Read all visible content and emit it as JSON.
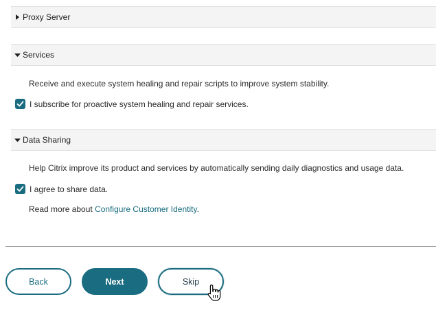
{
  "sections": {
    "proxy": {
      "title": "Proxy Server",
      "expanded": false
    },
    "services": {
      "title": "Services",
      "expanded": true,
      "description": "Receive and execute system healing and repair scripts to improve system stability.",
      "checkbox_label": "I subscribe for proactive system healing and repair services.",
      "checked": true
    },
    "data_sharing": {
      "title": "Data Sharing",
      "expanded": true,
      "description": "Help Citrix improve its product and services by automatically sending daily diagnostics and usage data.",
      "checkbox_label": "I agree to share data.",
      "checked": true,
      "read_more_prefix": "Read more about ",
      "read_more_link": "Configure Customer Identity",
      "read_more_suffix": "."
    }
  },
  "buttons": {
    "back": "Back",
    "next": "Next",
    "skip": "Skip"
  },
  "colors": {
    "accent": "#1a6c80",
    "header_bg": "#f4f4f4"
  },
  "icons": {
    "collapsed": "caret-right-icon",
    "expanded": "caret-down-icon",
    "check": "check-icon",
    "cursor": "hand-pointer-icon"
  }
}
